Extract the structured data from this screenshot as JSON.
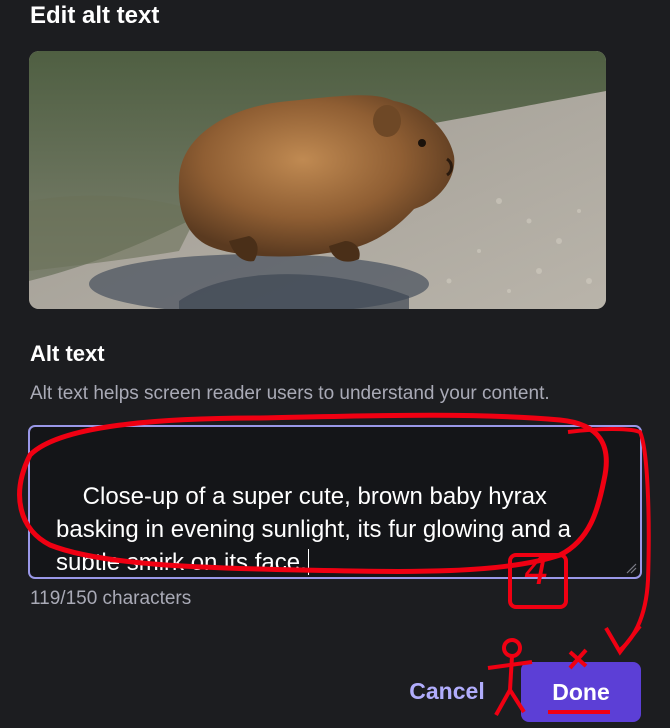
{
  "dialog": {
    "title": "Edit alt text",
    "image": {
      "subject": "baby hyrax photo"
    },
    "alt_text_section": {
      "heading": "Alt text",
      "hint": "Alt text helps screen reader users to understand your content.",
      "value": "Close-up of a super cute, brown baby hyrax basking in evening sunlight, its fur glowing and a subtle smirk on its face.",
      "counter": "119/150 characters"
    },
    "buttons": {
      "cancel_label": "Cancel",
      "done_label": "Done"
    }
  },
  "annotations": {
    "number": "4",
    "color": "#f00012"
  },
  "colors": {
    "background": "#1c1d20",
    "accent": "#5c3fd6",
    "textarea_border": "#9a98e8",
    "muted_text": "#a9aab6",
    "cancel_text": "#b1adfc"
  },
  "icons": [
    "resize-grip-icon"
  ]
}
